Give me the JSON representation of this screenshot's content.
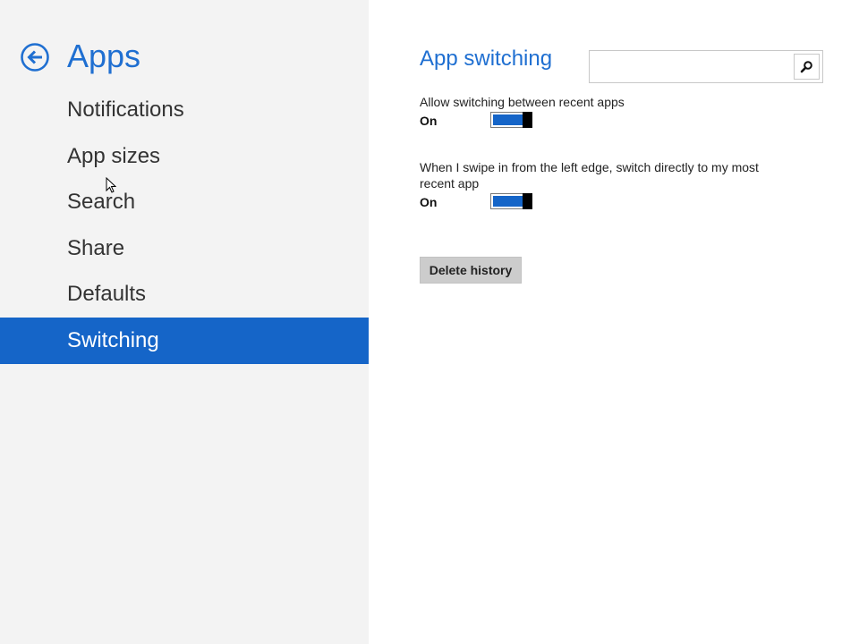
{
  "nav": {
    "title": "Apps",
    "items": [
      {
        "label": "Notifications",
        "selected": false
      },
      {
        "label": "App sizes",
        "selected": false
      },
      {
        "label": "Search",
        "selected": false
      },
      {
        "label": "Share",
        "selected": false
      },
      {
        "label": "Defaults",
        "selected": false
      },
      {
        "label": "Switching",
        "selected": true
      }
    ]
  },
  "content": {
    "title": "App switching",
    "search": {
      "value": "",
      "placeholder": ""
    },
    "settings": [
      {
        "label": "Allow switching between recent apps",
        "state": "On"
      },
      {
        "label": "When I swipe in from the left edge, switch directly to my most recent app",
        "state": "On"
      }
    ],
    "delete_label": "Delete history"
  },
  "colors": {
    "accent": "#1565c8",
    "nav_background": "#f3f3f3",
    "title": "#1f6fd1"
  },
  "icons": {
    "back": "back-arrow-circle-icon",
    "search": "search-icon"
  }
}
